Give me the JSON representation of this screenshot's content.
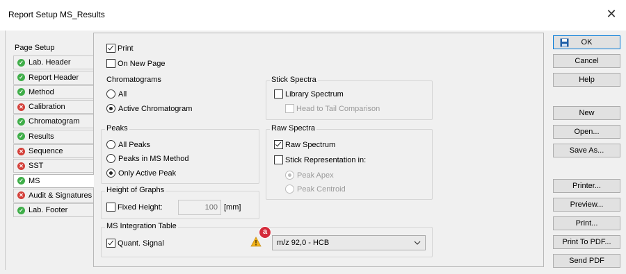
{
  "window": {
    "title": "Report Setup MS_Results",
    "close_glyph": "✕"
  },
  "tabs": {
    "header": "Page Setup",
    "items": [
      {
        "label": "Lab. Header",
        "status": "ok"
      },
      {
        "label": "Report Header",
        "status": "ok"
      },
      {
        "label": "Method",
        "status": "ok"
      },
      {
        "label": "Calibration",
        "status": "error"
      },
      {
        "label": "Chromatogram",
        "status": "ok"
      },
      {
        "label": "Results",
        "status": "ok"
      },
      {
        "label": "Sequence",
        "status": "error"
      },
      {
        "label": "SST",
        "status": "error"
      },
      {
        "label": "MS",
        "status": "ok",
        "active": true
      },
      {
        "label": "Audit & Signatures",
        "status": "error"
      },
      {
        "label": "Lab. Footer",
        "status": "ok"
      }
    ]
  },
  "print": {
    "label": "Print",
    "checked": true
  },
  "new_page": {
    "label": "On New Page",
    "checked": false
  },
  "chromatograms": {
    "title": "Chromatograms",
    "all": "All",
    "active": "Active Chromatogram",
    "selected": "active"
  },
  "peaks": {
    "title": "Peaks",
    "all": "All Peaks",
    "in_method": "Peaks in MS Method",
    "only_active": "Only Active Peak",
    "selected": "only_active"
  },
  "height": {
    "title": "Height of Graphs",
    "fixed_label": "Fixed Height:",
    "fixed_checked": false,
    "value": "100",
    "unit": "[mm]"
  },
  "ms_table": {
    "title": "MS Integration Table",
    "quant_label": "Quant. Signal",
    "quant_checked": true,
    "marker": "a",
    "select_value": "m/z 92,0 - HCB",
    "warning_icon": "warning-triangle"
  },
  "stick": {
    "title": "Stick Spectra",
    "library": "Library Spectrum",
    "library_checked": false,
    "head_to_tail": "Head to Tail Comparison",
    "head_to_tail_checked": false
  },
  "raw": {
    "title": "Raw Spectra",
    "raw_label": "Raw Spectrum",
    "raw_checked": true,
    "stick_rep": "Stick Representation in:",
    "stick_rep_checked": false,
    "apex": "Peak Apex",
    "centroid": "Peak Centroid",
    "selected": "apex"
  },
  "buttons": {
    "ok": "OK",
    "cancel": "Cancel",
    "help": "Help",
    "new": "New",
    "open": "Open...",
    "save_as": "Save As...",
    "printer": "Printer...",
    "preview": "Preview...",
    "print": "Print...",
    "print_pdf": "Print To PDF...",
    "send_pdf": "Send PDF"
  },
  "colors": {
    "ok": "#3fae49",
    "error": "#d4403a",
    "warning": "#f2b41b",
    "marker": "#d42a3a",
    "default_border": "#0078d7"
  }
}
